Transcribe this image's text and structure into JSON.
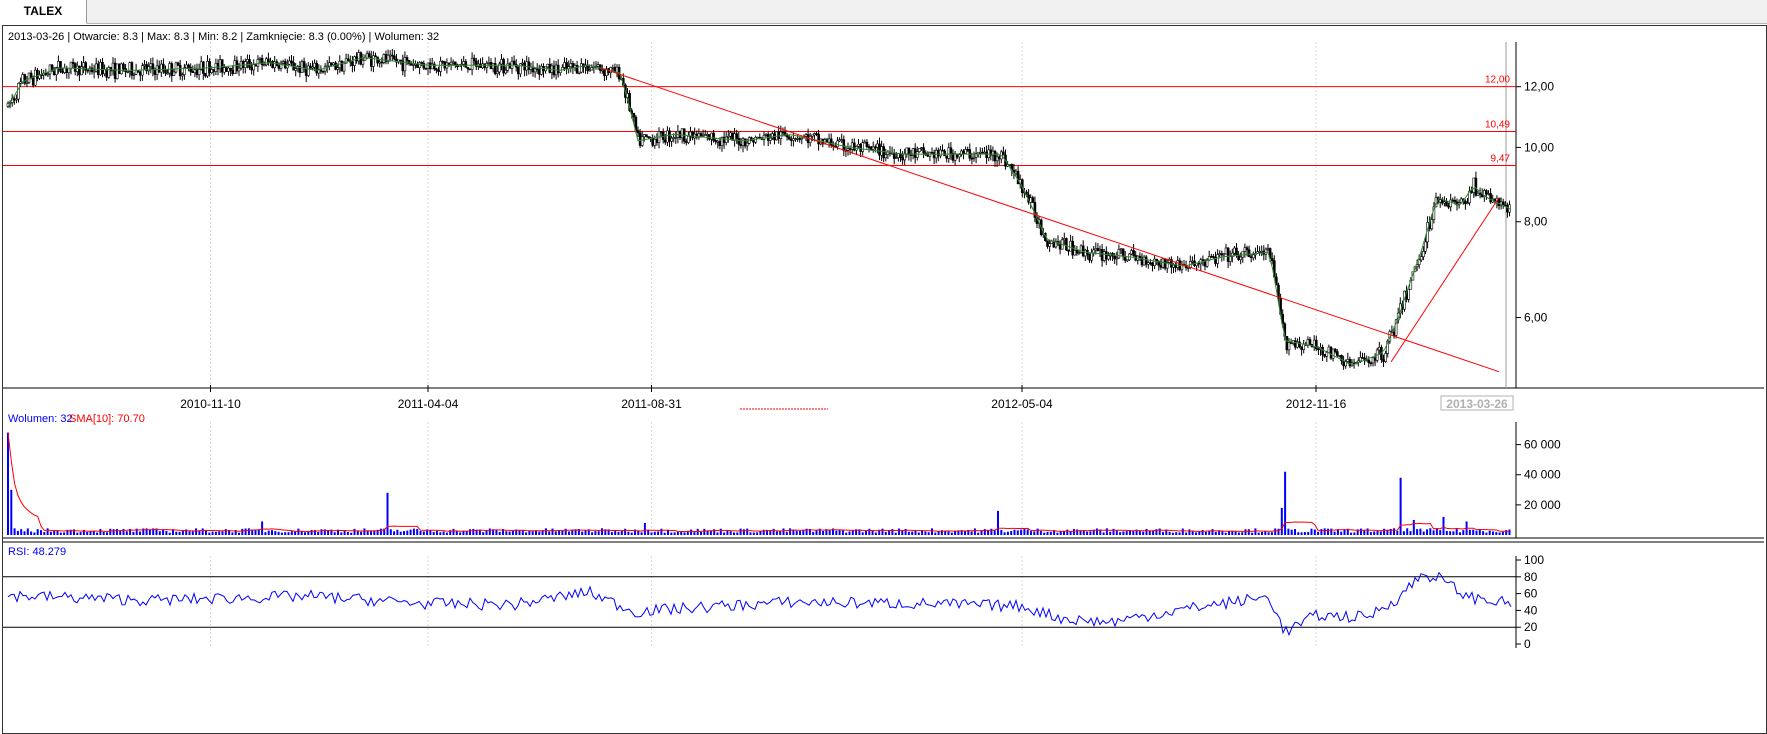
{
  "tab": {
    "label": "TALEX"
  },
  "info_bar": "2013-03-26 | Otwarcie: 8.3 | Max: 8.3 | Min: 8.2 | Zamknięcie: 8.3 (0.00%)  | Wolumen: 32",
  "volume_legend": {
    "vol": "Wolumen: 32",
    "sma": "SMA[10]: 70.70"
  },
  "rsi_legend": "RSI: 48.279",
  "colors": {
    "candle": "#000000",
    "sma": "#2e8b2e",
    "line": "#ff0000",
    "volume": "#0000ff",
    "rsi": "#0000ff",
    "grid": "#d9d9d9",
    "current_date_box": "#b0b0b0"
  },
  "chart_data": [
    {
      "type": "candlestick",
      "x_start": "2010-06-28",
      "x_end": "2013-03-26",
      "y_scale": "log",
      "ylim": [
        4.9,
        13.6
      ],
      "y_ticks": [
        "12,00",
        "10,00",
        "8,00",
        "6,00"
      ],
      "x_ticks": [
        "2010-11-10",
        "2011-04-04",
        "2011-08-31",
        "2012-05-04",
        "2012-11-16",
        "2013-03-26"
      ],
      "current_date_label": "2013-03-26",
      "price_path": [
        [
          "2010-06-28",
          11.3
        ],
        [
          "2010-07-08",
          12.2
        ],
        [
          "2010-08-01",
          12.7
        ],
        [
          "2010-09-15",
          12.6
        ],
        [
          "2010-11-10",
          12.7
        ],
        [
          "2010-12-20",
          12.9
        ],
        [
          "2011-01-20",
          12.6
        ],
        [
          "2011-02-20",
          13.1
        ],
        [
          "2011-04-04",
          12.8
        ],
        [
          "2011-06-01",
          12.8
        ],
        [
          "2011-07-01",
          12.6
        ],
        [
          "2011-07-20",
          12.8
        ],
        [
          "2011-08-10",
          12.5
        ],
        [
          "2011-08-22",
          10.2
        ],
        [
          "2011-09-15",
          10.4
        ],
        [
          "2011-11-01",
          10.2
        ],
        [
          "2011-12-01",
          10.4
        ],
        [
          "2012-01-10",
          10.0
        ],
        [
          "2012-02-15",
          9.8
        ],
        [
          "2012-03-20",
          9.8
        ],
        [
          "2012-04-20",
          9.8
        ],
        [
          "2012-05-04",
          8.9
        ],
        [
          "2012-05-20",
          7.6
        ],
        [
          "2012-06-15",
          7.3
        ],
        [
          "2012-07-15",
          7.2
        ],
        [
          "2012-08-20",
          7.0
        ],
        [
          "2012-09-15",
          7.2
        ],
        [
          "2012-10-16",
          7.3
        ],
        [
          "2012-10-26",
          5.6
        ],
        [
          "2012-11-16",
          5.5
        ],
        [
          "2012-12-10",
          5.2
        ],
        [
          "2012-12-31",
          5.4
        ],
        [
          "2013-01-10",
          6.0
        ],
        [
          "2013-01-25",
          7.3
        ],
        [
          "2013-02-05",
          8.6
        ],
        [
          "2013-02-20",
          8.4
        ],
        [
          "2013-03-01",
          8.9
        ],
        [
          "2013-03-10",
          8.6
        ],
        [
          "2013-03-26",
          8.3
        ]
      ],
      "hlines": [
        {
          "value": 12.0,
          "label": "12,00"
        },
        {
          "value": 10.49,
          "label": "10,49"
        },
        {
          "value": 9.47,
          "label": "9,47"
        }
      ],
      "trendlines": [
        {
          "from": [
            "2011-07-28",
            12.7
          ],
          "to": [
            "2013-03-18",
            5.1
          ]
        },
        {
          "from": [
            "2013-01-05",
            5.25
          ],
          "to": [
            "2013-03-18",
            8.6
          ]
        }
      ]
    },
    {
      "type": "bar",
      "name": "Wolumen",
      "ylim": [
        0,
        75000
      ],
      "y_ticks": [
        60000,
        40000,
        20000
      ],
      "y_tick_labels": [
        "60 000",
        "40 000",
        "20 000"
      ],
      "spikes": [
        [
          "2010-06-29",
          68000
        ],
        [
          "2010-07-01",
          30000
        ],
        [
          "2011-03-08",
          28000
        ],
        [
          "2010-12-15",
          9000
        ],
        [
          "2011-08-27",
          8000
        ],
        [
          "2012-04-18",
          16000
        ],
        [
          "2012-10-26",
          42000
        ],
        [
          "2012-10-24",
          18000
        ],
        [
          "2013-01-12",
          38000
        ],
        [
          "2013-01-20",
          10000
        ],
        [
          "2013-02-10",
          12000
        ],
        [
          "2013-02-25",
          9000
        ]
      ]
    },
    {
      "type": "line",
      "name": "RSI",
      "ylim": [
        0,
        100
      ],
      "y_ticks": [
        100,
        80,
        60,
        40,
        20,
        0
      ],
      "guides": [
        80,
        20
      ],
      "rsi_path": [
        [
          "2010-06-28",
          58
        ],
        [
          "2010-10-01",
          52
        ],
        [
          "2010-11-10",
          54
        ],
        [
          "2011-01-15",
          57
        ],
        [
          "2011-04-04",
          48
        ],
        [
          "2011-06-01",
          47
        ],
        [
          "2011-07-20",
          62
        ],
        [
          "2011-08-20",
          38
        ],
        [
          "2011-08-31",
          40
        ],
        [
          "2011-12-01",
          50
        ],
        [
          "2012-03-01",
          48
        ],
        [
          "2012-05-04",
          45
        ],
        [
          "2012-06-01",
          30
        ],
        [
          "2012-07-01",
          26
        ],
        [
          "2012-09-01",
          45
        ],
        [
          "2012-10-16",
          56
        ],
        [
          "2012-10-26",
          14
        ],
        [
          "2012-11-16",
          34
        ],
        [
          "2012-12-20",
          32
        ],
        [
          "2013-01-10",
          55
        ],
        [
          "2013-01-25",
          82
        ],
        [
          "2013-02-05",
          80
        ],
        [
          "2013-02-25",
          56
        ],
        [
          "2013-03-26",
          48
        ]
      ]
    }
  ]
}
